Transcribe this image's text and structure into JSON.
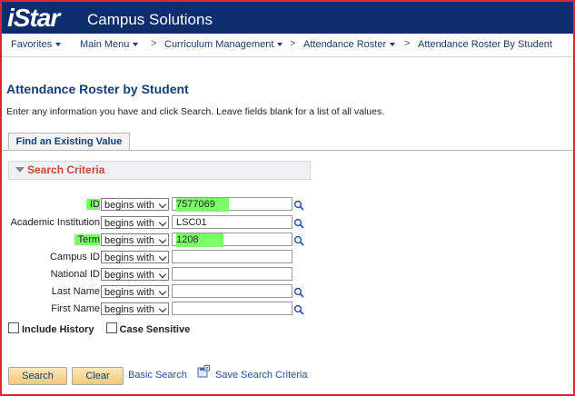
{
  "banner": {
    "logo_text": "iStar",
    "subtitle": "Campus Solutions",
    "color": "#0e2d6e"
  },
  "nav": {
    "favorites": "Favorites",
    "main_menu": "Main Menu",
    "curriculum_management": "Curriculum Management",
    "attendance_roster": "Attendance Roster",
    "attendance_roster_by_student": "Attendance Roster By Student",
    "separator": ">"
  },
  "page": {
    "title": "Attendance Roster by Student",
    "instructions": "Enter any information you have and click Search. Leave fields blank for a list of all values."
  },
  "tab": {
    "label": "Find an Existing Value"
  },
  "criteria": {
    "header": "Search Criteria",
    "fields": [
      {
        "label": "ID",
        "operator": "begins with",
        "value": "7577069",
        "highlight": true,
        "lookup": true
      },
      {
        "label": "Academic Institution",
        "operator": "begins with",
        "value": "LSC01",
        "highlight": false,
        "lookup": true
      },
      {
        "label": "Term",
        "operator": "begins with",
        "value": "1208",
        "highlight": true,
        "lookup": true
      },
      {
        "label": "Campus ID",
        "operator": "begins with",
        "value": "",
        "highlight": false,
        "lookup": false
      },
      {
        "label": "National ID",
        "operator": "begins with",
        "value": "",
        "highlight": false,
        "lookup": false
      },
      {
        "label": "Last Name",
        "operator": "begins with",
        "value": "",
        "highlight": false,
        "lookup": true
      },
      {
        "label": "First Name",
        "operator": "begins with",
        "value": "",
        "highlight": false,
        "lookup": true
      }
    ],
    "include_history": "Include History",
    "case_sensitive": "Case Sensitive",
    "highlight_color": "#7dff6a"
  },
  "actions": {
    "search": "Search",
    "clear": "Clear",
    "basic_search": "Basic Search",
    "save_search_criteria": "Save Search Criteria"
  }
}
